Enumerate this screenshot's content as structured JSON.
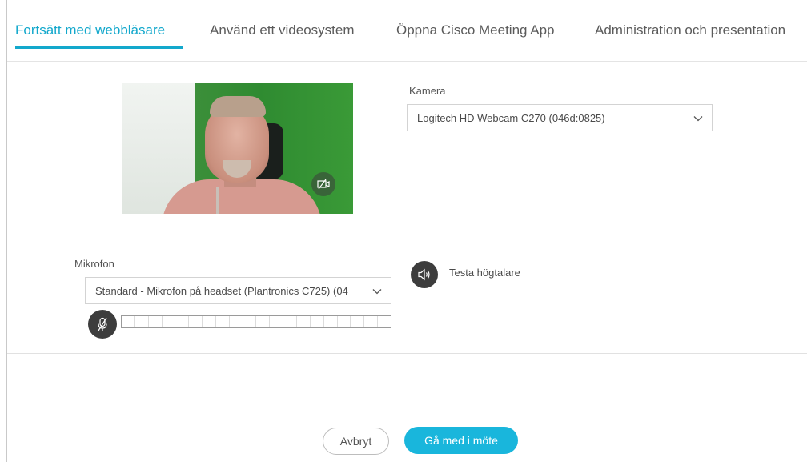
{
  "tabs": [
    {
      "label": "Fortsätt med webbläsare",
      "active": true
    },
    {
      "label": "Använd ett videosystem",
      "active": false
    },
    {
      "label": "Öppna Cisco Meeting App",
      "active": false
    },
    {
      "label": "Administration och presentation",
      "active": false
    }
  ],
  "camera": {
    "label": "Kamera",
    "selected": "Logitech HD Webcam C270 (046d:0825)",
    "toggle_icon": "camera-off-icon"
  },
  "microphone": {
    "label": "Mikrofon",
    "selected": "Standard - Mikrofon på headset (Plantronics C725) (04",
    "mute_icon": "mic-muted-icon",
    "level_segments": 20,
    "level": 0
  },
  "speaker": {
    "test_label": "Testa högtalare",
    "icon": "speaker-icon"
  },
  "actions": {
    "cancel_label": "Avbryt",
    "join_label": "Gå med i möte"
  },
  "colors": {
    "accent": "#13a8cc",
    "join_button": "#19b6dc",
    "icon_button": "#3d3d3d"
  }
}
